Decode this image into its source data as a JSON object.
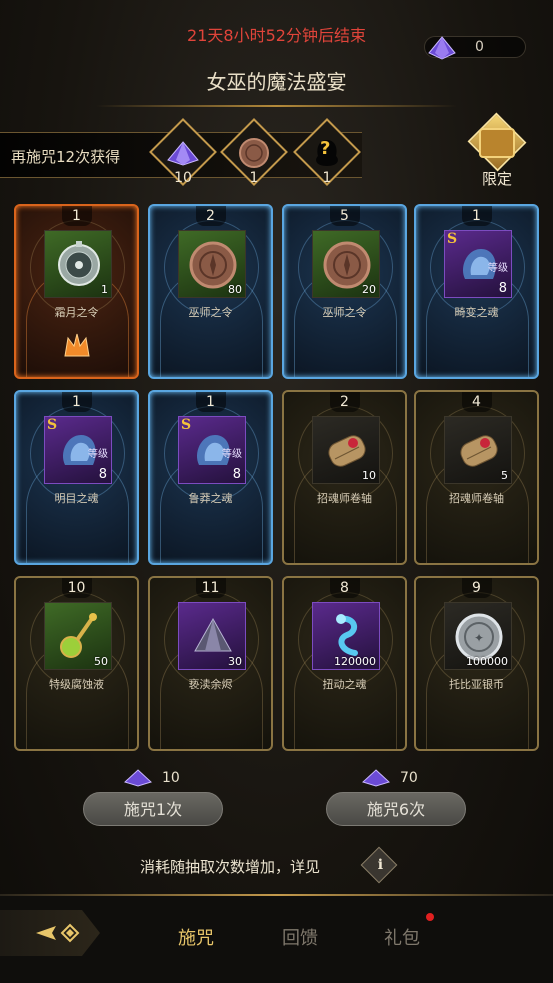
{
  "header": {
    "timer": "21天8小时52分钟后结束",
    "currency_value": "0",
    "currency_icon": "purple-gem-icon",
    "title": "女巫的魔法盛宴"
  },
  "bonus": {
    "text": "再施咒12次获得",
    "items": [
      {
        "icon": "purple-gem-icon",
        "count": "10"
      },
      {
        "icon": "bronze-coin-icon",
        "count": "1"
      },
      {
        "icon": "mystery-icon",
        "symbol": "?",
        "count": "1"
      }
    ]
  },
  "limited": {
    "label": "限定",
    "icon": "chest-icon"
  },
  "cards": [
    {
      "frame": "orange",
      "number": "1",
      "name": "霜月之令",
      "qty": "1",
      "bg": "green",
      "icon": "compass-icon"
    },
    {
      "frame": "blue",
      "number": "2",
      "name": "巫师之令",
      "qty": "80",
      "bg": "green",
      "icon": "bronze-coin-icon"
    },
    {
      "frame": "blue",
      "number": "5",
      "name": "巫师之令",
      "qty": "20",
      "bg": "green",
      "icon": "bronze-coin-icon"
    },
    {
      "frame": "blue",
      "number": "1",
      "name": "畸变之魂",
      "level_label": "等级",
      "level": "8",
      "s_badge": "S",
      "bg": "purple",
      "icon": "soul-icon"
    },
    {
      "frame": "blue",
      "number": "1",
      "name": "明目之魂",
      "level_label": "等级",
      "level": "8",
      "s_badge": "S",
      "bg": "purple",
      "icon": "soul-icon"
    },
    {
      "frame": "blue",
      "number": "1",
      "name": "鲁莽之魂",
      "level_label": "等级",
      "level": "8",
      "s_badge": "S",
      "bg": "purple",
      "icon": "soul-icon"
    },
    {
      "frame": "gold",
      "number": "2",
      "name": "招魂师卷轴",
      "qty": "10",
      "bg": "dark",
      "icon": "scroll-icon"
    },
    {
      "frame": "gold",
      "number": "4",
      "name": "招魂师卷轴",
      "qty": "5",
      "bg": "dark",
      "icon": "scroll-icon"
    },
    {
      "frame": "gold",
      "number": "10",
      "name": "特级腐蚀液",
      "qty": "50",
      "bg": "green",
      "icon": "potion-icon"
    },
    {
      "frame": "gold",
      "number": "11",
      "name": "亵渎余烬",
      "qty": "30",
      "bg": "purple",
      "icon": "ember-icon"
    },
    {
      "frame": "gold",
      "number": "8",
      "name": "扭动之魂",
      "qty": "120000",
      "bg": "purple",
      "icon": "wisp-icon"
    },
    {
      "frame": "gold",
      "number": "9",
      "name": "托比亚银币",
      "qty": "100000",
      "bg": "dark",
      "icon": "silver-coin-icon"
    }
  ],
  "cast_options": [
    {
      "cost": "10",
      "label": "施咒1次"
    },
    {
      "cost": "70",
      "label": "施咒6次"
    }
  ],
  "note": "消耗随抽取次数增加，详见",
  "info_symbol": "i",
  "nav": {
    "tabs": [
      "施咒",
      "回馈",
      "礼包"
    ],
    "active": 0
  },
  "colors": {
    "accent": "#e8c66a",
    "timer_red": "#e0443a",
    "orange_frame": "#d9641c",
    "blue_frame": "#5aa6e0",
    "gold_frame": "#8a7443"
  }
}
